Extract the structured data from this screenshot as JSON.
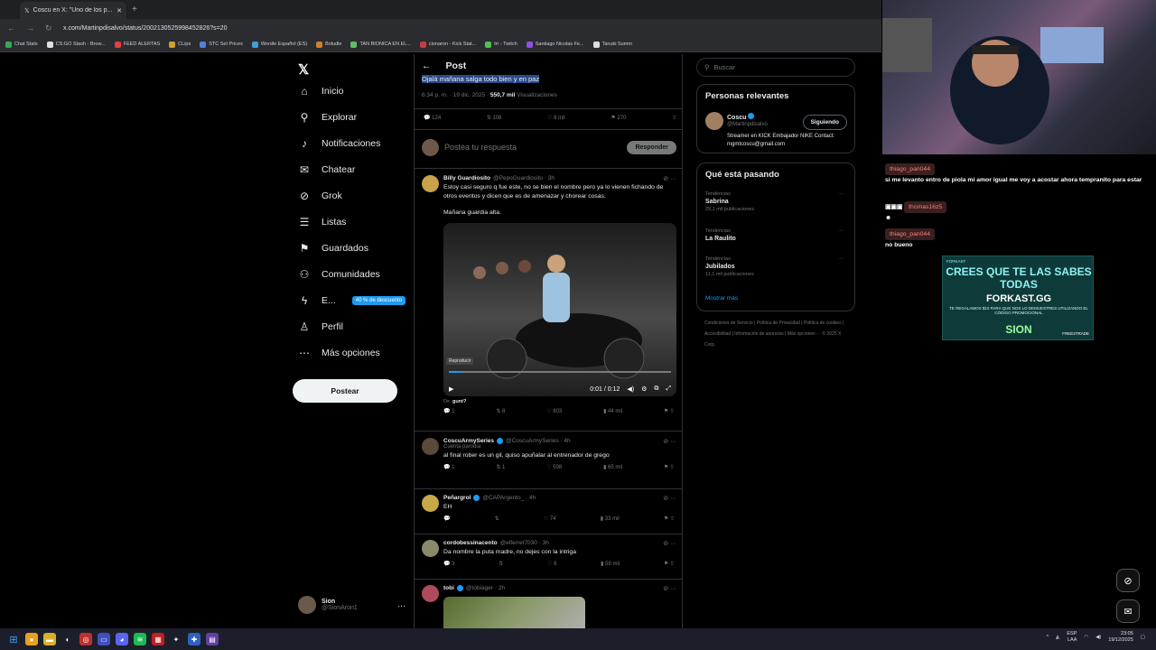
{
  "browser": {
    "tab_title": "Coscu en X: \"Uno de los p...",
    "url": "x.com/Martinpdisalvo/status/2002130525998452826?s=20",
    "bookmarks": [
      "Chat Stats",
      "CS:GO Stash - Brow...",
      "FEED ALERTAS",
      "CLips",
      "STC Set Prices",
      "Wordle Español (ES)",
      "Boludle",
      "TAN BIONICA EN EL...",
      "cionaron - Kick Stat...",
      "trr - Twitch",
      "Santiago Nicolas Fe...",
      "Tanuki Summ"
    ]
  },
  "nav": {
    "items": [
      {
        "label": "Inicio",
        "icon": "home-icon",
        "glyph": "⌂"
      },
      {
        "label": "Explorar",
        "icon": "search-icon",
        "glyph": "⚲"
      },
      {
        "label": "Notificaciones",
        "icon": "bell-icon",
        "glyph": "♪"
      },
      {
        "label": "Chatear",
        "icon": "mail-icon",
        "glyph": "✉"
      },
      {
        "label": "Grok",
        "icon": "grok-icon",
        "glyph": "⊘"
      },
      {
        "label": "Listas",
        "icon": "list-icon",
        "glyph": "☰"
      },
      {
        "label": "Guardados",
        "icon": "bookmark-icon",
        "glyph": "⚑"
      },
      {
        "label": "Comunidades",
        "icon": "people-icon",
        "glyph": "⚇"
      },
      {
        "label": "E...",
        "icon": "bolt-icon",
        "glyph": "ϟ"
      },
      {
        "label": "Perfil",
        "icon": "person-icon",
        "glyph": "♙"
      },
      {
        "label": "Más opciones",
        "icon": "more-icon",
        "glyph": "⋯"
      }
    ],
    "promo_badge": "40 % de descuento",
    "post_button": "Postear",
    "user": {
      "name": "Sion",
      "handle": "@SionAron1"
    }
  },
  "post": {
    "header": "Post",
    "highlight_text": "Ojalá mañana salga todo bien y en paz",
    "time": "6:34 p. m. · 19 dic. 2025 ·",
    "views": "550,7 mil",
    "views_label": "Visualizaciones",
    "stats": {
      "replies": "124",
      "reposts": "106",
      "likes": "8 mil",
      "bookmarks": "270"
    },
    "reply_placeholder": "Postea tu respuesta",
    "reply_button": "Responder"
  },
  "replies": [
    {
      "name": "Billy Guardiosito",
      "handle": "@PepoGuardiosito · 3h",
      "text": "Estoy casi seguro q fue este, no se bien el nombre pero ya lo vienen fichando de otros eventos y dicen que es de amenazar y chorear cosas.",
      "text2": "Mañana guardia alta.",
      "video_label": "Reproducir",
      "video_time": "0:01 / 0:12",
      "from": "De",
      "from_user": "gunt?",
      "acts": [
        "1",
        "8",
        "803",
        "44 mil"
      ]
    },
    {
      "name": "CoscuArmySeries",
      "handle": "@CoscuArmySeries · 4h",
      "sub": "Cuenta parodia",
      "text": "al final rober es un gil, quiso apuñalar al entrenador de grego",
      "acts": [
        "1",
        "1",
        "598",
        "65 mil"
      ]
    },
    {
      "name": "Peñargrol",
      "handle": "@CAPArgento_ · 4h",
      "text": "EH",
      "acts": [
        "",
        "",
        "74",
        "33 mil"
      ]
    },
    {
      "name": "cordobessinacento",
      "handle": "@elferret7030 · 3h",
      "text": "Da nombre la puta madre, no dejes con la intriga",
      "acts": [
        "3",
        "",
        "6",
        "59 mil"
      ]
    },
    {
      "name": "tobi",
      "handle": "@tobiager · 2h",
      "text": "",
      "acts": []
    }
  ],
  "right": {
    "search_placeholder": "Buscar",
    "relevant_title": "Personas relevantes",
    "person": {
      "name": "Coscu",
      "handle": "@Martinpdisalvo",
      "follow": "Siguiendo",
      "bio": "Streamer en KICK Embajador NIKE Contact: mgmtcoscu@gmail.com"
    },
    "trending_title": "Qué está pasando",
    "trends": [
      {
        "cat": "Tendencias",
        "name": "Sabrina",
        "count": "29,1 mil publicaciones"
      },
      {
        "cat": "Tendencias",
        "name": "La Raulito",
        "count": ""
      },
      {
        "cat": "Tendencias",
        "name": "Jubilados",
        "count": "11,1 mil publicaciones"
      }
    ],
    "show_more": "Mostrar más",
    "footer": "Condiciones de Servicio | Política de Privacidad | Política de cookies | Accesibilidad | Información de anuncios | Más opciones ··· © 2025 X Corp."
  },
  "stream_chat": [
    {
      "user": "thiago_pan044",
      "text": "si me levanto entro de piola mi amor igual me voy a acostar ahora tempranito para estar"
    },
    {
      "user": "thomas16z5",
      "text": ""
    },
    {
      "user": "thiago_pan044",
      "text": "no bueno"
    }
  ],
  "ad": {
    "tag": "FORKAST",
    "line1": "CREES QUE TE LAS SABES TODAS",
    "line2": "FORKAST.GG",
    "line3": "TE REGALAMOS $10 PARA QUE NOS LO DEMUESTRES UTILIZANDO EL CÓDIGO PROMOCIONAL",
    "line4": "SION",
    "line5": "FREE2TRADE"
  },
  "taskbar": {
    "lang": "ESP",
    "lang2": "LAA",
    "time": "23:05",
    "date": "19/12/2025"
  }
}
